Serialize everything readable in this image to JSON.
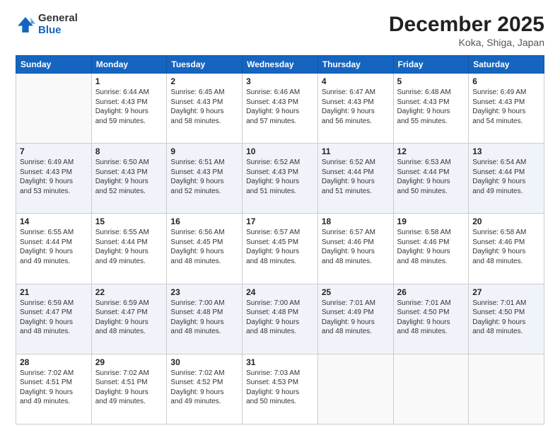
{
  "logo": {
    "general": "General",
    "blue": "Blue"
  },
  "header": {
    "month": "December 2025",
    "location": "Koka, Shiga, Japan"
  },
  "weekdays": [
    "Sunday",
    "Monday",
    "Tuesday",
    "Wednesday",
    "Thursday",
    "Friday",
    "Saturday"
  ],
  "weeks": [
    [
      {
        "day": "",
        "info": ""
      },
      {
        "day": "1",
        "info": "Sunrise: 6:44 AM\nSunset: 4:43 PM\nDaylight: 9 hours\nand 59 minutes."
      },
      {
        "day": "2",
        "info": "Sunrise: 6:45 AM\nSunset: 4:43 PM\nDaylight: 9 hours\nand 58 minutes."
      },
      {
        "day": "3",
        "info": "Sunrise: 6:46 AM\nSunset: 4:43 PM\nDaylight: 9 hours\nand 57 minutes."
      },
      {
        "day": "4",
        "info": "Sunrise: 6:47 AM\nSunset: 4:43 PM\nDaylight: 9 hours\nand 56 minutes."
      },
      {
        "day": "5",
        "info": "Sunrise: 6:48 AM\nSunset: 4:43 PM\nDaylight: 9 hours\nand 55 minutes."
      },
      {
        "day": "6",
        "info": "Sunrise: 6:49 AM\nSunset: 4:43 PM\nDaylight: 9 hours\nand 54 minutes."
      }
    ],
    [
      {
        "day": "7",
        "info": "Sunrise: 6:49 AM\nSunset: 4:43 PM\nDaylight: 9 hours\nand 53 minutes."
      },
      {
        "day": "8",
        "info": "Sunrise: 6:50 AM\nSunset: 4:43 PM\nDaylight: 9 hours\nand 52 minutes."
      },
      {
        "day": "9",
        "info": "Sunrise: 6:51 AM\nSunset: 4:43 PM\nDaylight: 9 hours\nand 52 minutes."
      },
      {
        "day": "10",
        "info": "Sunrise: 6:52 AM\nSunset: 4:43 PM\nDaylight: 9 hours\nand 51 minutes."
      },
      {
        "day": "11",
        "info": "Sunrise: 6:52 AM\nSunset: 4:44 PM\nDaylight: 9 hours\nand 51 minutes."
      },
      {
        "day": "12",
        "info": "Sunrise: 6:53 AM\nSunset: 4:44 PM\nDaylight: 9 hours\nand 50 minutes."
      },
      {
        "day": "13",
        "info": "Sunrise: 6:54 AM\nSunset: 4:44 PM\nDaylight: 9 hours\nand 49 minutes."
      }
    ],
    [
      {
        "day": "14",
        "info": "Sunrise: 6:55 AM\nSunset: 4:44 PM\nDaylight: 9 hours\nand 49 minutes."
      },
      {
        "day": "15",
        "info": "Sunrise: 6:55 AM\nSunset: 4:44 PM\nDaylight: 9 hours\nand 49 minutes."
      },
      {
        "day": "16",
        "info": "Sunrise: 6:56 AM\nSunset: 4:45 PM\nDaylight: 9 hours\nand 48 minutes."
      },
      {
        "day": "17",
        "info": "Sunrise: 6:57 AM\nSunset: 4:45 PM\nDaylight: 9 hours\nand 48 minutes."
      },
      {
        "day": "18",
        "info": "Sunrise: 6:57 AM\nSunset: 4:46 PM\nDaylight: 9 hours\nand 48 minutes."
      },
      {
        "day": "19",
        "info": "Sunrise: 6:58 AM\nSunset: 4:46 PM\nDaylight: 9 hours\nand 48 minutes."
      },
      {
        "day": "20",
        "info": "Sunrise: 6:58 AM\nSunset: 4:46 PM\nDaylight: 9 hours\nand 48 minutes."
      }
    ],
    [
      {
        "day": "21",
        "info": "Sunrise: 6:59 AM\nSunset: 4:47 PM\nDaylight: 9 hours\nand 48 minutes."
      },
      {
        "day": "22",
        "info": "Sunrise: 6:59 AM\nSunset: 4:47 PM\nDaylight: 9 hours\nand 48 minutes."
      },
      {
        "day": "23",
        "info": "Sunrise: 7:00 AM\nSunset: 4:48 PM\nDaylight: 9 hours\nand 48 minutes."
      },
      {
        "day": "24",
        "info": "Sunrise: 7:00 AM\nSunset: 4:48 PM\nDaylight: 9 hours\nand 48 minutes."
      },
      {
        "day": "25",
        "info": "Sunrise: 7:01 AM\nSunset: 4:49 PM\nDaylight: 9 hours\nand 48 minutes."
      },
      {
        "day": "26",
        "info": "Sunrise: 7:01 AM\nSunset: 4:50 PM\nDaylight: 9 hours\nand 48 minutes."
      },
      {
        "day": "27",
        "info": "Sunrise: 7:01 AM\nSunset: 4:50 PM\nDaylight: 9 hours\nand 48 minutes."
      }
    ],
    [
      {
        "day": "28",
        "info": "Sunrise: 7:02 AM\nSunset: 4:51 PM\nDaylight: 9 hours\nand 49 minutes."
      },
      {
        "day": "29",
        "info": "Sunrise: 7:02 AM\nSunset: 4:51 PM\nDaylight: 9 hours\nand 49 minutes."
      },
      {
        "day": "30",
        "info": "Sunrise: 7:02 AM\nSunset: 4:52 PM\nDaylight: 9 hours\nand 49 minutes."
      },
      {
        "day": "31",
        "info": "Sunrise: 7:03 AM\nSunset: 4:53 PM\nDaylight: 9 hours\nand 50 minutes."
      },
      {
        "day": "",
        "info": ""
      },
      {
        "day": "",
        "info": ""
      },
      {
        "day": "",
        "info": ""
      }
    ]
  ]
}
